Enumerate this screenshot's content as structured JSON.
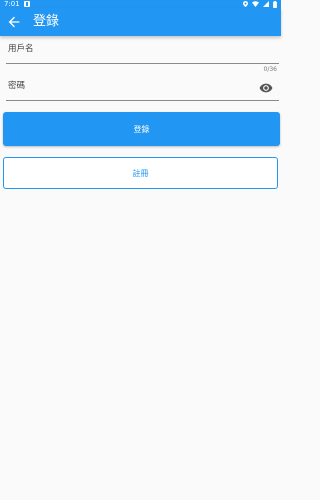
{
  "status_bar": {
    "time": "7:01",
    "icons": [
      "notification-icon",
      "location-icon",
      "wifi-icon",
      "signal-icon",
      "battery-icon"
    ]
  },
  "app_bar": {
    "title": "登錄",
    "back_icon": "arrow-back-icon",
    "color": "#2196f3"
  },
  "form": {
    "username": {
      "placeholder": "用戶名",
      "value": "",
      "counter": "0/36"
    },
    "password": {
      "placeholder": "密碼",
      "value": "",
      "toggle_icon": "eye-icon"
    }
  },
  "actions": {
    "login_label": "登錄",
    "register_label": "註冊"
  }
}
